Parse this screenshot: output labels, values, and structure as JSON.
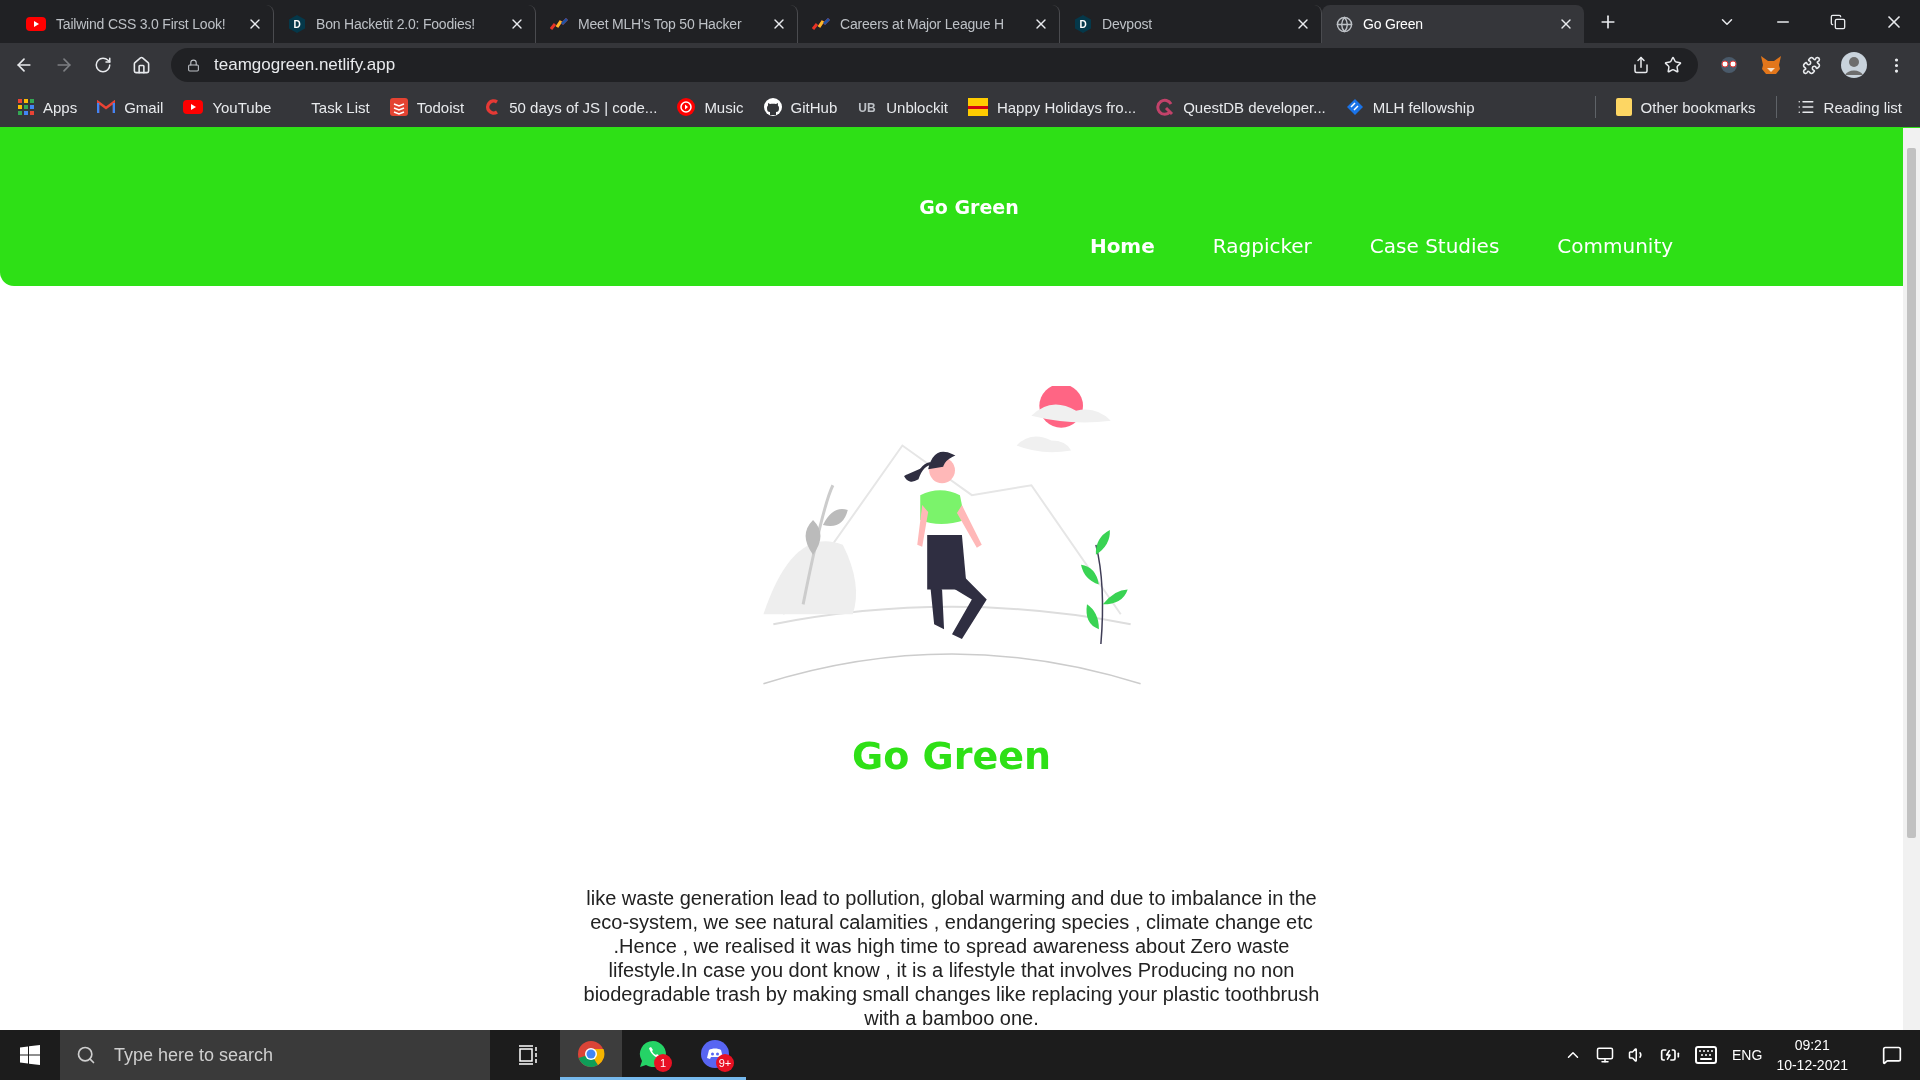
{
  "browser": {
    "tabs": [
      {
        "title": "Tailwind CSS 3.0 First Look!",
        "kind": "video",
        "selected": false
      },
      {
        "title": "Bon Hacketit 2.0: Foodies!",
        "kind": "letter",
        "icon_letter": "D",
        "selected": false
      },
      {
        "title": "Meet MLH's Top 50 Hacker",
        "kind": "stripes",
        "selected": false
      },
      {
        "title": "Careers at Major League H",
        "kind": "stripes",
        "selected": false
      },
      {
        "title": "Devpost",
        "kind": "letter",
        "icon_letter": "D",
        "selected": false
      },
      {
        "title": "Go Green",
        "kind": "globe",
        "selected": true
      }
    ],
    "address": "teamgogreen.netlify.app",
    "bookmarks": [
      {
        "label": "Apps",
        "kind": "grid"
      },
      {
        "label": "Gmail",
        "kind": "mail"
      },
      {
        "label": "YouTube",
        "kind": "video"
      },
      {
        "label": "Task List",
        "kind": "none"
      },
      {
        "label": "Todoist",
        "kind": "stack"
      },
      {
        "label": "50 days of JS | code...",
        "kind": "c"
      },
      {
        "label": "Music",
        "kind": "record"
      },
      {
        "label": "GitHub",
        "kind": "cat"
      },
      {
        "label": "Unblockit",
        "kind": "letter",
        "icon_letter": "UB"
      },
      {
        "label": "Happy Holidays fro...",
        "kind": "banner"
      },
      {
        "label": "QuestDB developer...",
        "kind": "q"
      },
      {
        "label": "MLH fellowship",
        "kind": "diamond"
      }
    ],
    "other_bookmarks": "Other bookmarks",
    "reading_list": "Reading list"
  },
  "site": {
    "brand": "Go Green",
    "nav": [
      {
        "label": "Home",
        "selected": true
      },
      {
        "label": "Ragpicker",
        "selected": false
      },
      {
        "label": "Case Studies",
        "selected": false
      },
      {
        "label": "Community",
        "selected": false
      }
    ],
    "heading": "Go Green",
    "paragraph": "like waste generation lead to pollution, global warming and due to imbalance in the eco-system, we see natural calamities , endangering species , climate change etc .Hence , we realised it was high time to spread awareness about Zero waste lifestyle.In case you dont know , it is a lifestyle that involves Producing no non biodegradable trash by making small changes like replacing your plastic toothbrush with a bamboo one."
  },
  "taskbar": {
    "search_placeholder": "Type here to search",
    "apps": [
      {
        "kind": "browser",
        "selected": true
      },
      {
        "kind": "chat",
        "badge": "1",
        "selected": false
      },
      {
        "kind": "game",
        "badge": "9+",
        "selected": false
      }
    ],
    "language": "ENG",
    "time": "09:21",
    "date": "10-12-2021"
  }
}
